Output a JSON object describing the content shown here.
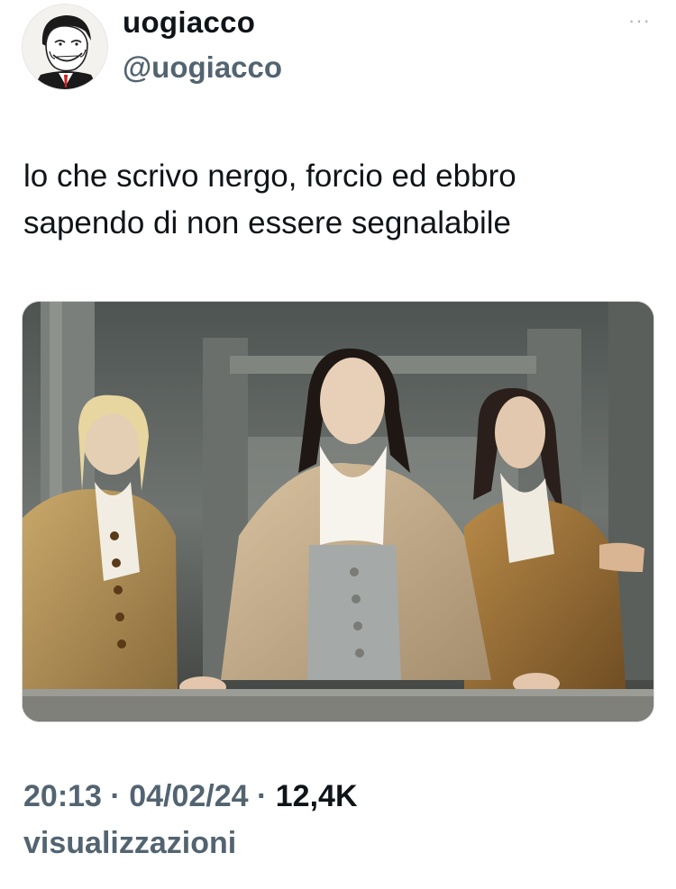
{
  "author": {
    "display_name": "uogiacco",
    "handle": "@uogiacco",
    "avatar_icon": "troll-face-avatar"
  },
  "more_icon": "···",
  "tweet": {
    "line1": "lo che scrivo nergo, forcio ed ebbro",
    "line2": "sapendo di non essere segnalabile"
  },
  "media": {
    "description_icon": "photo-three-men-18th-century-costumes"
  },
  "meta": {
    "time": "20:13",
    "sep1": " · ",
    "date": "04/02/24",
    "sep2": " · ",
    "views_count": "12,4K",
    "views_label": "visualizzazioni"
  },
  "colors": {
    "text": "#0f1419",
    "secondary": "#536471"
  }
}
